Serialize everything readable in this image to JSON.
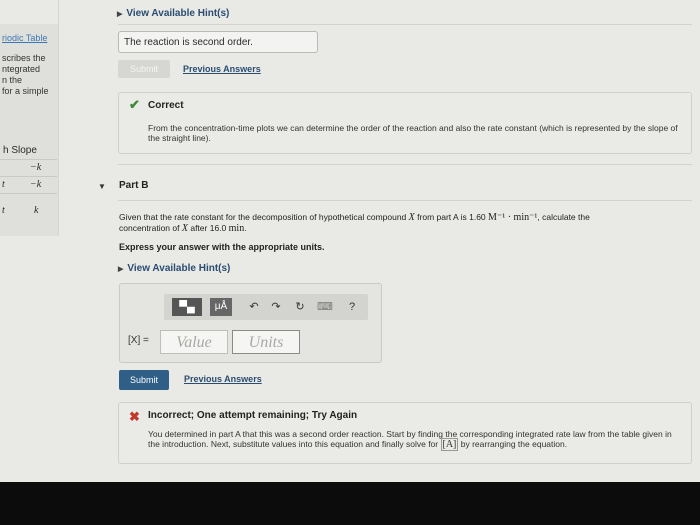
{
  "sidebar": {
    "link": "riodic Table",
    "text_lines": [
      "scribes the",
      "ntegrated",
      "n the",
      "for a simple"
    ],
    "table": {
      "header": "h Slope",
      "rows": [
        {
          "left": "",
          "value": "−k"
        },
        {
          "left": "t",
          "value": "−k"
        },
        {
          "left": "t",
          "value": "k"
        }
      ]
    }
  },
  "top_hint": {
    "label": "View Available Hint(s)"
  },
  "part_a": {
    "answer": "The reaction is second order.",
    "submit_label": "Submit",
    "previous_answers": "Previous Answers",
    "feedback": {
      "icon": "✔",
      "title": "Correct",
      "text": "From the concentration-time plots we can determine the order of the reaction and also the rate constant (which is represented by the slope of the straight line)."
    }
  },
  "part_b": {
    "label": "Part B",
    "question_pre": "Given that the rate constant for the decomposition of hypothetical compound",
    "question_var": "X",
    "question_mid": "from part A is 1.60",
    "question_units": "M⁻¹ · min⁻¹",
    "question_post": ", calculate the",
    "question_line2_pre": "concentration of",
    "question_line2_var": "X",
    "question_line2_post": "after 16.0",
    "question_line2_unit": "min",
    "question_line2_end": ".",
    "express": "Express your answer with the appropriate units.",
    "hint_label": "View Available Hint(s)",
    "toolbar": {
      "templates_label": "▀▄",
      "mu_label": "μÅ",
      "undo": "↶",
      "redo": "↷",
      "reset": "↻",
      "keyboard": "⌨",
      "help": "?"
    },
    "input_label": "[X] =",
    "value_placeholder": "Value",
    "units_placeholder": "Units",
    "submit_label": "Submit",
    "previous_answers": "Previous Answers",
    "feedback": {
      "icon": "✖",
      "title": "Incorrect; One attempt remaining; Try Again",
      "text_pre": "You determined in part A that this was a second order reaction. Start by finding the corresponding integrated rate law from the table given in the introduction. Next, substitute values into this equation and finally solve for",
      "text_var": "[A]",
      "text_post": "by rearranging the equation."
    }
  },
  "colors": {
    "correct": "#3d8b37",
    "incorrect": "#c0392b",
    "submit": "#2f5f87",
    "link": "#2a4d70"
  }
}
